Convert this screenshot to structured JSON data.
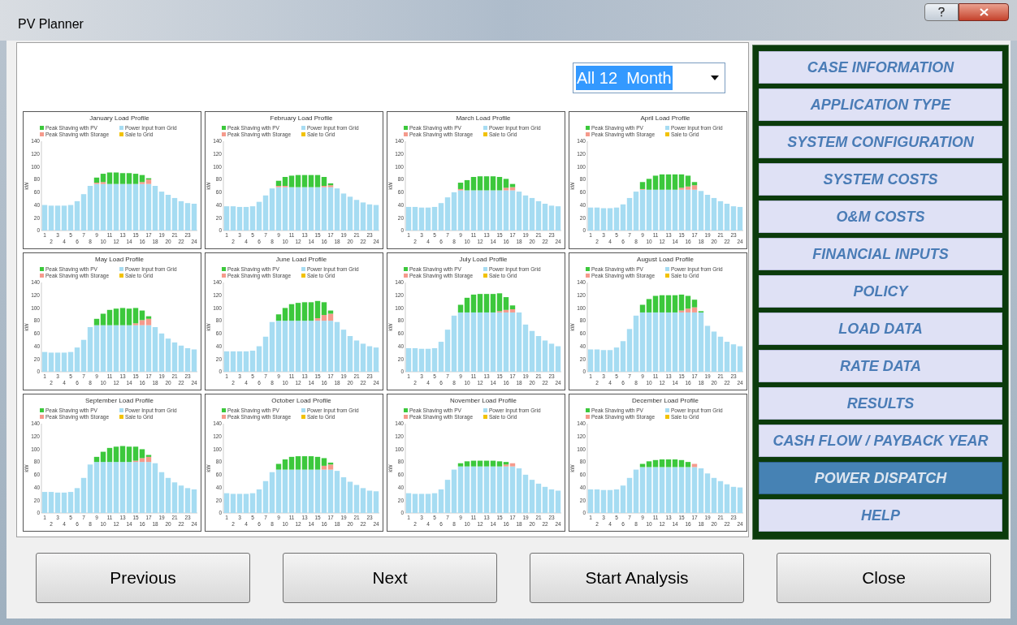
{
  "window": {
    "title": "PV Planner"
  },
  "dropdown": {
    "value": "All 12  Month"
  },
  "charts": [
    {
      "chart_data": {
        "type": "bar",
        "stacked": true,
        "legend": "top",
        "title": "January Load Profile",
        "ylabel": "kW",
        "ylim": [
          0,
          140
        ],
        "yticks": [
          0,
          20,
          40,
          60,
          80,
          100,
          120,
          140
        ],
        "categories": [
          "1",
          "2",
          "3",
          "4",
          "5",
          "6",
          "7",
          "8",
          "9",
          "10",
          "11",
          "12",
          "13",
          "14",
          "15",
          "16",
          "17",
          "18",
          "19",
          "20",
          "21",
          "22",
          "23",
          "24"
        ],
        "series": [
          {
            "name": "Power Input from Grid",
            "color": "#a6dcf2",
            "values": [
              40,
              39,
              39,
              39,
              40,
              46,
              57,
              70,
              73,
              73,
              73,
              73,
              73,
              73,
              73,
              73,
              73,
              70,
              61,
              56,
              51,
              46,
              43,
              42
            ]
          },
          {
            "name": "Peak Shaving with Storage",
            "color": "#f59a8c",
            "values": [
              0,
              0,
              0,
              0,
              0,
              0,
              0,
              0,
              2,
              3,
              0,
              0,
              0,
              0,
              0,
              3,
              7,
              0,
              0,
              0,
              0,
              0,
              0,
              0
            ]
          },
          {
            "name": "Peak Shaving with PV",
            "color": "#3cc83c",
            "values": [
              0,
              0,
              0,
              0,
              0,
              0,
              0,
              0,
              8,
              13,
              18,
              18,
              17,
              17,
              16,
              11,
              2,
              0,
              0,
              0,
              0,
              0,
              0,
              0
            ]
          },
          {
            "name": "Sale to Grid",
            "color": "#f2c200",
            "values": [
              0,
              0,
              0,
              0,
              0,
              0,
              0,
              0,
              0,
              0,
              0,
              0,
              0,
              0,
              0,
              0,
              0,
              0,
              0,
              0,
              0,
              0,
              0,
              0
            ]
          }
        ]
      }
    },
    {
      "chart_data": {
        "type": "bar",
        "stacked": true,
        "legend": "top",
        "title": "February Load Profile",
        "ylabel": "kW",
        "ylim": [
          0,
          140
        ],
        "yticks": [
          0,
          20,
          40,
          60,
          80,
          100,
          120,
          140
        ],
        "categories": [
          "1",
          "2",
          "3",
          "4",
          "5",
          "6",
          "7",
          "8",
          "9",
          "10",
          "11",
          "12",
          "13",
          "14",
          "15",
          "16",
          "17",
          "18",
          "19",
          "20",
          "21",
          "22",
          "23",
          "24"
        ],
        "series": [
          {
            "name": "Power Input from Grid",
            "color": "#a6dcf2",
            "values": [
              38,
              38,
              37,
              37,
              38,
              45,
              55,
              66,
              68,
              68,
              68,
              68,
              68,
              68,
              68,
              68,
              68,
              66,
              58,
              53,
              48,
              44,
              41,
              40
            ]
          },
          {
            "name": "Peak Shaving with Storage",
            "color": "#f59a8c",
            "values": [
              0,
              0,
              0,
              0,
              0,
              0,
              0,
              0,
              2,
              2,
              0,
              0,
              0,
              0,
              0,
              2,
              3,
              0,
              0,
              0,
              0,
              0,
              0,
              0
            ]
          },
          {
            "name": "Peak Shaving with PV",
            "color": "#3cc83c",
            "values": [
              0,
              0,
              0,
              0,
              0,
              0,
              0,
              0,
              8,
              14,
              18,
              19,
              19,
              19,
              19,
              14,
              3,
              0,
              0,
              0,
              0,
              0,
              0,
              0
            ]
          },
          {
            "name": "Sale to Grid",
            "color": "#f2c200",
            "values": [
              0,
              0,
              0,
              0,
              0,
              0,
              0,
              0,
              0,
              0,
              0,
              0,
              0,
              0,
              0,
              0,
              0,
              0,
              0,
              0,
              0,
              0,
              0,
              0
            ]
          }
        ]
      }
    },
    {
      "chart_data": {
        "type": "bar",
        "stacked": true,
        "legend": "top",
        "title": "March Load Profile",
        "ylabel": "kW",
        "ylim": [
          0,
          140
        ],
        "yticks": [
          0,
          20,
          40,
          60,
          80,
          100,
          120,
          140
        ],
        "categories": [
          "1",
          "2",
          "3",
          "4",
          "5",
          "6",
          "7",
          "8",
          "9",
          "10",
          "11",
          "12",
          "13",
          "14",
          "15",
          "16",
          "17",
          "18",
          "19",
          "20",
          "21",
          "22",
          "23",
          "24"
        ],
        "series": [
          {
            "name": "Power Input from Grid",
            "color": "#a6dcf2",
            "values": [
              37,
              37,
              36,
              36,
              37,
              43,
              52,
              60,
              63,
              63,
              63,
              63,
              63,
              63,
              63,
              63,
              63,
              61,
              55,
              51,
              46,
              42,
              39,
              38
            ]
          },
          {
            "name": "Peak Shaving with Storage",
            "color": "#f59a8c",
            "values": [
              0,
              0,
              0,
              0,
              0,
              0,
              0,
              0,
              2,
              0,
              0,
              0,
              0,
              0,
              0,
              4,
              5,
              0,
              0,
              0,
              0,
              0,
              0,
              0
            ]
          },
          {
            "name": "Peak Shaving with PV",
            "color": "#3cc83c",
            "values": [
              0,
              0,
              0,
              0,
              0,
              0,
              0,
              0,
              10,
              16,
              21,
              22,
              22,
              22,
              21,
              14,
              5,
              0,
              0,
              0,
              0,
              0,
              0,
              0
            ]
          },
          {
            "name": "Sale to Grid",
            "color": "#f2c200",
            "values": [
              0,
              0,
              0,
              0,
              0,
              0,
              0,
              0,
              0,
              0,
              0,
              0,
              0,
              0,
              0,
              0,
              0,
              0,
              0,
              0,
              0,
              0,
              0,
              0
            ]
          }
        ]
      }
    },
    {
      "chart_data": {
        "type": "bar",
        "stacked": true,
        "legend": "top",
        "title": "April Load Profile",
        "ylabel": "kW",
        "ylim": [
          0,
          140
        ],
        "yticks": [
          0,
          20,
          40,
          60,
          80,
          100,
          120,
          140
        ],
        "categories": [
          "1",
          "2",
          "3",
          "4",
          "5",
          "6",
          "7",
          "8",
          "9",
          "10",
          "11",
          "12",
          "13",
          "14",
          "15",
          "16",
          "17",
          "18",
          "19",
          "20",
          "21",
          "22",
          "23",
          "24"
        ],
        "series": [
          {
            "name": "Power Input from Grid",
            "color": "#a6dcf2",
            "values": [
              36,
              36,
              35,
              35,
              36,
              41,
              51,
              61,
              64,
              64,
              64,
              64,
              64,
              64,
              64,
              64,
              64,
              62,
              56,
              51,
              46,
              42,
              38,
              37
            ]
          },
          {
            "name": "Peak Shaving with Storage",
            "color": "#f59a8c",
            "values": [
              0,
              0,
              0,
              0,
              0,
              0,
              0,
              0,
              1,
              0,
              0,
              0,
              0,
              0,
              3,
              5,
              7,
              0,
              0,
              0,
              0,
              0,
              0,
              0
            ]
          },
          {
            "name": "Peak Shaving with PV",
            "color": "#3cc83c",
            "values": [
              0,
              0,
              0,
              0,
              0,
              0,
              0,
              0,
              11,
              17,
              22,
              24,
              24,
              24,
              21,
              17,
              5,
              0,
              0,
              0,
              0,
              0,
              0,
              0
            ]
          },
          {
            "name": "Sale to Grid",
            "color": "#f2c200",
            "values": [
              0,
              0,
              0,
              0,
              0,
              0,
              0,
              0,
              0,
              0,
              0,
              0,
              0,
              0,
              0,
              0,
              0,
              0,
              0,
              0,
              0,
              0,
              0,
              0
            ]
          }
        ]
      }
    },
    {
      "chart_data": {
        "type": "bar",
        "stacked": true,
        "legend": "top",
        "title": "May Load Profile",
        "ylabel": "kW",
        "ylim": [
          0,
          140
        ],
        "yticks": [
          0,
          20,
          40,
          60,
          80,
          100,
          120,
          140
        ],
        "categories": [
          "1",
          "2",
          "3",
          "4",
          "5",
          "6",
          "7",
          "8",
          "9",
          "10",
          "11",
          "12",
          "13",
          "14",
          "15",
          "16",
          "17",
          "18",
          "19",
          "20",
          "21",
          "22",
          "23",
          "24"
        ],
        "series": [
          {
            "name": "Power Input from Grid",
            "color": "#a6dcf2",
            "values": [
              31,
              30,
              30,
              30,
              31,
              38,
              50,
              70,
              73,
              73,
              73,
              73,
              73,
              73,
              73,
              73,
              73,
              70,
              60,
              52,
              46,
              41,
              37,
              35
            ]
          },
          {
            "name": "Peak Shaving with Storage",
            "color": "#f59a8c",
            "values": [
              0,
              0,
              0,
              0,
              0,
              0,
              0,
              0,
              0,
              0,
              0,
              0,
              0,
              0,
              3,
              8,
              10,
              0,
              0,
              0,
              0,
              0,
              0,
              0
            ]
          },
          {
            "name": "Peak Shaving with PV",
            "color": "#3cc83c",
            "values": [
              0,
              0,
              0,
              0,
              0,
              0,
              0,
              0,
              10,
              18,
              24,
              26,
              27,
              26,
              24,
              15,
              4,
              0,
              0,
              0,
              0,
              0,
              0,
              0
            ]
          },
          {
            "name": "Sale to Grid",
            "color": "#f2c200",
            "values": [
              0,
              0,
              0,
              0,
              0,
              0,
              0,
              0,
              0,
              0,
              0,
              0,
              0,
              0,
              0,
              0,
              0,
              0,
              0,
              0,
              0,
              0,
              0,
              0
            ]
          }
        ]
      }
    },
    {
      "chart_data": {
        "type": "bar",
        "stacked": true,
        "legend": "top",
        "title": "June Load Profile",
        "ylabel": "kW",
        "ylim": [
          0,
          140
        ],
        "yticks": [
          0,
          20,
          40,
          60,
          80,
          100,
          120,
          140
        ],
        "categories": [
          "1",
          "2",
          "3",
          "4",
          "5",
          "6",
          "7",
          "8",
          "9",
          "10",
          "11",
          "12",
          "13",
          "14",
          "15",
          "16",
          "17",
          "18",
          "19",
          "20",
          "21",
          "22",
          "23",
          "24"
        ],
        "series": [
          {
            "name": "Power Input from Grid",
            "color": "#a6dcf2",
            "values": [
              32,
              32,
              32,
              32,
              33,
              40,
              55,
              78,
              80,
              80,
              80,
              80,
              80,
              80,
              80,
              80,
              80,
              78,
              66,
              56,
              49,
              44,
              40,
              38
            ]
          },
          {
            "name": "Peak Shaving with Storage",
            "color": "#f59a8c",
            "values": [
              0,
              0,
              0,
              0,
              0,
              0,
              0,
              0,
              0,
              0,
              0,
              0,
              0,
              0,
              4,
              9,
              11,
              0,
              0,
              0,
              0,
              0,
              0,
              0
            ]
          },
          {
            "name": "Peak Shaving with PV",
            "color": "#3cc83c",
            "values": [
              0,
              0,
              0,
              0,
              0,
              0,
              0,
              0,
              10,
              20,
              26,
              28,
              29,
              29,
              27,
              20,
              5,
              0,
              0,
              0,
              0,
              0,
              0,
              0
            ]
          },
          {
            "name": "Sale to Grid",
            "color": "#f2c200",
            "values": [
              0,
              0,
              0,
              0,
              0,
              0,
              0,
              0,
              0,
              0,
              0,
              0,
              0,
              0,
              0,
              0,
              0,
              0,
              0,
              0,
              0,
              0,
              0,
              0
            ]
          }
        ]
      }
    },
    {
      "chart_data": {
        "type": "bar",
        "stacked": true,
        "legend": "top",
        "title": "July Load Profile",
        "ylabel": "kW",
        "ylim": [
          0,
          140
        ],
        "yticks": [
          0,
          20,
          40,
          60,
          80,
          100,
          120,
          140
        ],
        "categories": [
          "1",
          "2",
          "3",
          "4",
          "5",
          "6",
          "7",
          "8",
          "9",
          "10",
          "11",
          "12",
          "13",
          "14",
          "15",
          "16",
          "17",
          "18",
          "19",
          "20",
          "21",
          "22",
          "23",
          "24"
        ],
        "series": [
          {
            "name": "Power Input from Grid",
            "color": "#a6dcf2",
            "values": [
              37,
              37,
              36,
              36,
              37,
              47,
              66,
              88,
              93,
              93,
              93,
              93,
              93,
              93,
              93,
              93,
              93,
              93,
              74,
              64,
              56,
              49,
              44,
              40
            ]
          },
          {
            "name": "Peak Shaving with Storage",
            "color": "#f59a8c",
            "values": [
              0,
              0,
              0,
              0,
              0,
              0,
              0,
              0,
              0,
              0,
              0,
              0,
              0,
              0,
              2,
              4,
              5,
              0,
              0,
              0,
              0,
              0,
              0,
              0
            ]
          },
          {
            "name": "Peak Shaving with PV",
            "color": "#3cc83c",
            "values": [
              0,
              0,
              0,
              0,
              0,
              0,
              0,
              0,
              12,
              23,
              28,
              29,
              29,
              29,
              28,
              20,
              6,
              0,
              0,
              0,
              0,
              0,
              0,
              0
            ]
          },
          {
            "name": "Sale to Grid",
            "color": "#f2c200",
            "values": [
              0,
              0,
              0,
              0,
              0,
              0,
              0,
              0,
              0,
              0,
              0,
              0,
              0,
              0,
              0,
              0,
              0,
              0,
              0,
              0,
              0,
              0,
              0,
              0
            ]
          }
        ]
      }
    },
    {
      "chart_data": {
        "type": "bar",
        "stacked": true,
        "legend": "top",
        "title": "August Load Profile",
        "ylabel": "kW",
        "ylim": [
          0,
          140
        ],
        "yticks": [
          0,
          20,
          40,
          60,
          80,
          100,
          120,
          140
        ],
        "categories": [
          "1",
          "2",
          "3",
          "4",
          "5",
          "6",
          "7",
          "8",
          "9",
          "10",
          "11",
          "12",
          "13",
          "14",
          "15",
          "16",
          "17",
          "18",
          "19",
          "20",
          "21",
          "22",
          "23",
          "24"
        ],
        "series": [
          {
            "name": "Power Input from Grid",
            "color": "#a6dcf2",
            "values": [
              35,
              35,
              34,
              34,
              38,
              48,
              67,
              88,
              93,
              93,
              93,
              93,
              93,
              93,
              93,
              93,
              93,
              93,
              72,
              63,
              55,
              47,
              43,
              40
            ]
          },
          {
            "name": "Peak Shaving with Storage",
            "color": "#f59a8c",
            "values": [
              0,
              0,
              0,
              0,
              0,
              0,
              0,
              0,
              0,
              0,
              0,
              0,
              0,
              0,
              3,
              6,
              8,
              0,
              0,
              0,
              0,
              0,
              0,
              0
            ]
          },
          {
            "name": "Peak Shaving with PV",
            "color": "#3cc83c",
            "values": [
              0,
              0,
              0,
              0,
              0,
              0,
              0,
              0,
              12,
              21,
              26,
              27,
              27,
              27,
              25,
              20,
              12,
              2,
              0,
              0,
              0,
              0,
              0,
              0
            ]
          },
          {
            "name": "Sale to Grid",
            "color": "#f2c200",
            "values": [
              0,
              0,
              0,
              0,
              0,
              0,
              0,
              0,
              0,
              0,
              0,
              0,
              0,
              0,
              0,
              0,
              0,
              0,
              0,
              0,
              0,
              0,
              0,
              0
            ]
          }
        ]
      }
    },
    {
      "chart_data": {
        "type": "bar",
        "stacked": true,
        "legend": "top",
        "title": "September Load Profile",
        "ylabel": "kW",
        "ylim": [
          0,
          140
        ],
        "yticks": [
          0,
          20,
          40,
          60,
          80,
          100,
          120,
          140
        ],
        "categories": [
          "1",
          "2",
          "3",
          "4",
          "5",
          "6",
          "7",
          "8",
          "9",
          "10",
          "11",
          "12",
          "13",
          "14",
          "15",
          "16",
          "17",
          "18",
          "19",
          "20",
          "21",
          "22",
          "23",
          "24"
        ],
        "series": [
          {
            "name": "Power Input from Grid",
            "color": "#a6dcf2",
            "values": [
              33,
              33,
              32,
              32,
              33,
              39,
              55,
              76,
              80,
              80,
              80,
              80,
              80,
              80,
              80,
              80,
              80,
              78,
              64,
              55,
              48,
              43,
              39,
              37
            ]
          },
          {
            "name": "Peak Shaving with Storage",
            "color": "#f59a8c",
            "values": [
              0,
              0,
              0,
              0,
              0,
              0,
              0,
              0,
              0,
              0,
              0,
              0,
              0,
              0,
              2,
              6,
              8,
              0,
              0,
              0,
              0,
              0,
              0,
              0
            ]
          },
          {
            "name": "Peak Shaving with PV",
            "color": "#3cc83c",
            "values": [
              0,
              0,
              0,
              0,
              0,
              0,
              0,
              0,
              8,
              16,
              22,
              24,
              25,
              24,
              22,
              14,
              3,
              0,
              0,
              0,
              0,
              0,
              0,
              0
            ]
          },
          {
            "name": "Sale to Grid",
            "color": "#f2c200",
            "values": [
              0,
              0,
              0,
              0,
              0,
              0,
              0,
              0,
              0,
              0,
              0,
              0,
              0,
              0,
              0,
              0,
              0,
              0,
              0,
              0,
              0,
              0,
              0,
              0
            ]
          }
        ]
      }
    },
    {
      "chart_data": {
        "type": "bar",
        "stacked": true,
        "legend": "top",
        "title": "October Load Profile",
        "ylabel": "kW",
        "ylim": [
          0,
          140
        ],
        "yticks": [
          0,
          20,
          40,
          60,
          80,
          100,
          120,
          140
        ],
        "categories": [
          "1",
          "2",
          "3",
          "4",
          "5",
          "6",
          "7",
          "8",
          "9",
          "10",
          "11",
          "12",
          "13",
          "14",
          "15",
          "16",
          "17",
          "18",
          "19",
          "20",
          "21",
          "22",
          "23",
          "24"
        ],
        "series": [
          {
            "name": "Power Input from Grid",
            "color": "#a6dcf2",
            "values": [
              31,
              30,
              30,
              30,
              31,
              37,
              50,
              64,
              68,
              68,
              68,
              68,
              68,
              68,
              68,
              68,
              68,
              66,
              56,
              49,
              44,
              39,
              35,
              34
            ]
          },
          {
            "name": "Peak Shaving with Storage",
            "color": "#f59a8c",
            "values": [
              0,
              0,
              0,
              0,
              0,
              0,
              0,
              0,
              0,
              0,
              0,
              0,
              0,
              0,
              0,
              6,
              8,
              0,
              0,
              0,
              0,
              0,
              0,
              0
            ]
          },
          {
            "name": "Peak Shaving with PV",
            "color": "#3cc83c",
            "values": [
              0,
              0,
              0,
              0,
              0,
              0,
              0,
              0,
              9,
              16,
              20,
              21,
              21,
              21,
              20,
              12,
              3,
              0,
              0,
              0,
              0,
              0,
              0,
              0
            ]
          },
          {
            "name": "Sale to Grid",
            "color": "#f2c200",
            "values": [
              0,
              0,
              0,
              0,
              0,
              0,
              0,
              0,
              0,
              0,
              0,
              0,
              0,
              0,
              0,
              0,
              0,
              0,
              0,
              0,
              0,
              0,
              0,
              0
            ]
          }
        ]
      }
    },
    {
      "chart_data": {
        "type": "bar",
        "stacked": true,
        "legend": "top",
        "title": "November Load Profile",
        "ylabel": "kW",
        "ylim": [
          0,
          140
        ],
        "yticks": [
          0,
          20,
          40,
          60,
          80,
          100,
          120,
          140
        ],
        "categories": [
          "1",
          "2",
          "3",
          "4",
          "5",
          "6",
          "7",
          "8",
          "9",
          "10",
          "11",
          "12",
          "13",
          "14",
          "15",
          "16",
          "17",
          "18",
          "19",
          "20",
          "21",
          "22",
          "23",
          "24"
        ],
        "series": [
          {
            "name": "Power Input from Grid",
            "color": "#a6dcf2",
            "values": [
              31,
              30,
              30,
              30,
              31,
              37,
              52,
              68,
              73,
              73,
              73,
              73,
              73,
              73,
              73,
              73,
              73,
              70,
              60,
              52,
              46,
              41,
              37,
              35
            ]
          },
          {
            "name": "Peak Shaving with Storage",
            "color": "#f59a8c",
            "values": [
              0,
              0,
              0,
              0,
              0,
              0,
              0,
              0,
              0,
              0,
              0,
              0,
              0,
              0,
              0,
              3,
              5,
              0,
              0,
              0,
              0,
              0,
              0,
              0
            ]
          },
          {
            "name": "Peak Shaving with PV",
            "color": "#3cc83c",
            "values": [
              0,
              0,
              0,
              0,
              0,
              0,
              0,
              0,
              5,
              8,
              9,
              9,
              9,
              9,
              8,
              4,
              0,
              0,
              0,
              0,
              0,
              0,
              0,
              0
            ]
          },
          {
            "name": "Sale to Grid",
            "color": "#f2c200",
            "values": [
              0,
              0,
              0,
              0,
              0,
              0,
              0,
              0,
              0,
              0,
              0,
              0,
              0,
              0,
              0,
              0,
              0,
              0,
              0,
              0,
              0,
              0,
              0,
              0
            ]
          }
        ]
      }
    },
    {
      "chart_data": {
        "type": "bar",
        "stacked": true,
        "legend": "top",
        "title": "December Load Profile",
        "ylabel": "kW",
        "ylim": [
          0,
          140
        ],
        "yticks": [
          0,
          20,
          40,
          60,
          80,
          100,
          120,
          140
        ],
        "categories": [
          "1",
          "2",
          "3",
          "4",
          "5",
          "6",
          "7",
          "8",
          "9",
          "10",
          "11",
          "12",
          "13",
          "14",
          "15",
          "16",
          "17",
          "18",
          "19",
          "20",
          "21",
          "22",
          "23",
          "24"
        ],
        "series": [
          {
            "name": "Power Input from Grid",
            "color": "#a6dcf2",
            "values": [
              37,
              37,
              36,
              36,
              37,
              43,
              55,
              68,
              72,
              72,
              72,
              72,
              72,
              72,
              72,
              72,
              72,
              70,
              62,
              55,
              50,
              45,
              41,
              40
            ]
          },
          {
            "name": "Peak Shaving with Storage",
            "color": "#f59a8c",
            "values": [
              0,
              0,
              0,
              0,
              0,
              0,
              0,
              0,
              0,
              0,
              0,
              0,
              0,
              0,
              0,
              0,
              5,
              0,
              0,
              0,
              0,
              0,
              0,
              0
            ]
          },
          {
            "name": "Peak Shaving with PV",
            "color": "#3cc83c",
            "values": [
              0,
              0,
              0,
              0,
              0,
              0,
              0,
              0,
              5,
              9,
              11,
              12,
              12,
              12,
              11,
              8,
              0,
              0,
              0,
              0,
              0,
              0,
              0,
              0
            ]
          },
          {
            "name": "Sale to Grid",
            "color": "#f2c200",
            "values": [
              0,
              0,
              0,
              0,
              0,
              0,
              0,
              0,
              0,
              0,
              0,
              0,
              0,
              0,
              0,
              0,
              0,
              0,
              0,
              0,
              0,
              0,
              0,
              0
            ]
          }
        ]
      }
    }
  ],
  "nav_items": [
    {
      "label": "CASE INFORMATION",
      "selected": false
    },
    {
      "label": "APPLICATION TYPE",
      "selected": false
    },
    {
      "label": "SYSTEM CONFIGURATION",
      "selected": false
    },
    {
      "label": "SYSTEM COSTS",
      "selected": false
    },
    {
      "label": "O&M COSTS",
      "selected": false
    },
    {
      "label": "FINANCIAL INPUTS",
      "selected": false
    },
    {
      "label": "POLICY",
      "selected": false
    },
    {
      "label": "LOAD DATA",
      "selected": false
    },
    {
      "label": "RATE DATA",
      "selected": false
    },
    {
      "label": "RESULTS",
      "selected": false
    },
    {
      "label": "CASH FLOW / PAYBACK YEAR",
      "selected": false
    },
    {
      "label": "POWER DISPATCH",
      "selected": true
    },
    {
      "label": "HELP",
      "selected": false
    }
  ],
  "buttons": [
    "Previous",
    "Next",
    "Start Analysis",
    "Close"
  ]
}
